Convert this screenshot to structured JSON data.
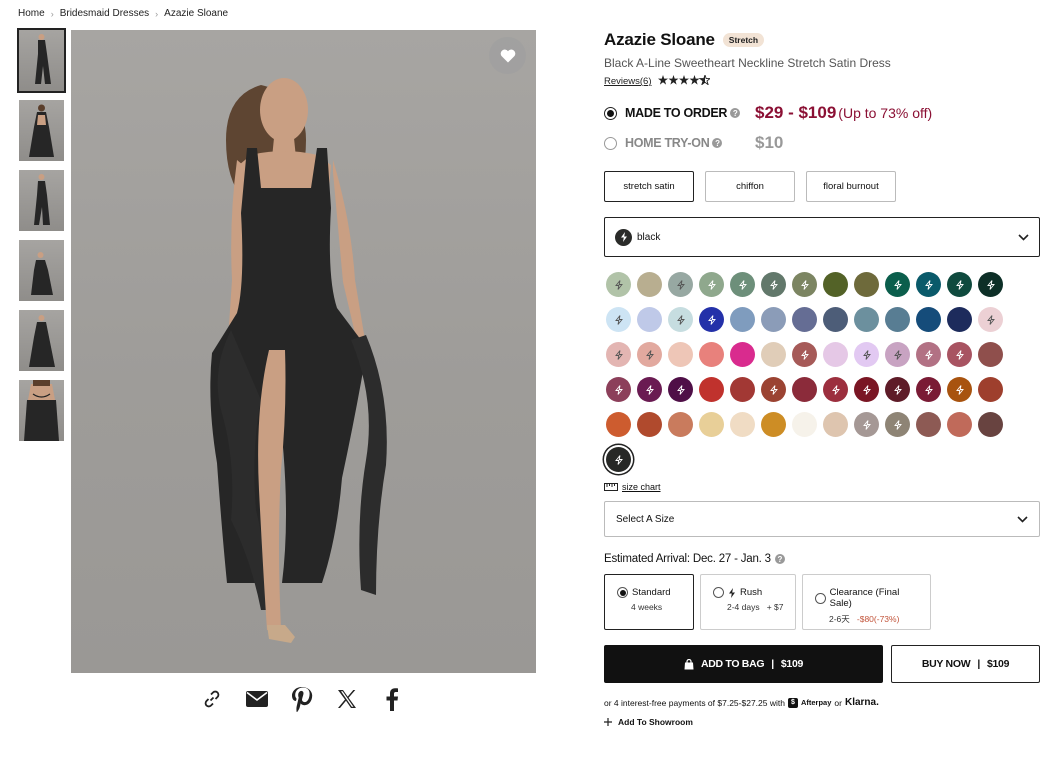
{
  "breadcrumb": {
    "home": "Home",
    "category": "Bridesmaid Dresses",
    "current": "Azazie Sloane"
  },
  "product": {
    "title": "Azazie Sloane",
    "badge": "Stretch",
    "subtitle": "Black A-Line Sweetheart Neckline Stretch Satin Dress",
    "reviews_link": "Reviews(6)",
    "rating": 4.5
  },
  "pricing": {
    "made_to_order_label": "MADE TO ORDER",
    "made_to_order_price": "$29 - $109",
    "made_to_order_off": "(Up to 73% off)",
    "home_tryon_label": "HOME TRY-ON",
    "home_tryon_price": "$10"
  },
  "fabrics": [
    {
      "label": "stretch satin",
      "selected": true
    },
    {
      "label": "chiffon",
      "selected": false
    },
    {
      "label": "floral burnout",
      "selected": false
    }
  ],
  "color_dropdown": {
    "value": "black"
  },
  "swatch_colors": [
    "#b1c3a8",
    "#b8ae90",
    "#97a8a2",
    "#8fa88d",
    "#6d8f7a",
    "#62786b",
    "#7c8562",
    "#536227",
    "#6e6a3b",
    "#0b5e4c",
    "#0a5a6a",
    "#0f4a3e",
    "#0d2f27",
    "#cde4f4",
    "#bfc9e8",
    "#c6dde0",
    "#2431a9",
    "#7f9cbe",
    "#8b9cb8",
    "#656d94",
    "#4d5d78",
    "#6c909e",
    "#587d93",
    "#154c7a",
    "#1d2b5c",
    "#ecd0d4",
    "#e3b5b2",
    "#e2a99f",
    "#eec6b7",
    "#e8817c",
    "#d92b8e",
    "#e0cdb8",
    "#a65a58",
    "#e5c8e6",
    "#e2c9f2",
    "#c8a3c2",
    "#b27184",
    "#a85361",
    "#8f4f4c",
    "#8c3f5a",
    "#6a1b52",
    "#4f0f47",
    "#c0322d",
    "#a23834",
    "#9b4332",
    "#8b2b3a",
    "#9c2f3e",
    "#7a1624",
    "#5e1c28",
    "#7a1b35",
    "#a8530f",
    "#9e3f2d",
    "#cd5c2f",
    "#b04a2d",
    "#c97b5d",
    "#e8cf98",
    "#f0dcc4",
    "#cd8d25",
    "#f6f2ea",
    "#dec5af",
    "#a59895",
    "#8e8475",
    "#8d5a54",
    "#c06a5a",
    "#684340",
    "#272826"
  ],
  "selected_swatch_index": 65,
  "size": {
    "chart_label": "size chart",
    "placeholder": "Select A Size"
  },
  "arrival": {
    "label": "Estimated Arrival: Dec. 27 - Jan. 3"
  },
  "shipping": [
    {
      "name": "Standard",
      "detail": "4 weeks",
      "selected": true
    },
    {
      "name": "Rush",
      "detail": "2-4 days",
      "extra": "+ $7",
      "selected": false
    },
    {
      "name": "Clearance (Final Sale)",
      "detail": "2-6天",
      "extra": "-$80(-73%)",
      "selected": false
    }
  ],
  "buttons": {
    "add_to_bag": "ADD TO BAG",
    "add_to_bag_price": "$109",
    "buy_now": "BUY NOW",
    "buy_now_price": "$109"
  },
  "afterpay": {
    "text": "or 4 interest-free payments of $7.25-$27.25 with",
    "afterpay": "Afterpay",
    "or": "or",
    "klarna": "Klarna."
  },
  "showroom": {
    "label": "Add To Showroom"
  }
}
